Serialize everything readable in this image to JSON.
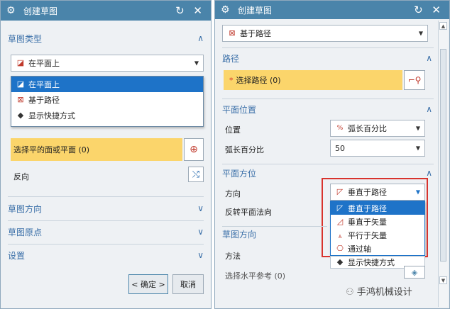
{
  "left": {
    "title": "创建草图",
    "title_controls": "↻ ✕",
    "sections": {
      "sketch_type": "草图类型",
      "sketch_orient": "草图方向",
      "sketch_origin": "草图原点",
      "settings": "设置"
    },
    "type_select": "在平面上",
    "type_options": [
      "在平面上",
      "基于路径",
      "显示快捷方式"
    ],
    "select_plane": "选择平的面或平面 (0)",
    "reverse": "反向",
    "ok": "< 确定 >",
    "cancel": "取消"
  },
  "right": {
    "title": "创建草图",
    "title_controls": "↻ ✕",
    "type_select": "基于路径",
    "sections": {
      "path": "路径",
      "plane_pos": "平面位置",
      "plane_orient": "平面方位",
      "sketch_orient": "草图方向"
    },
    "select_path": "选择路径 (0)",
    "required_mark": "*",
    "position_label": "位置",
    "position_value": "弧长百分比",
    "arc_label": "弧长百分比",
    "arc_value": "50",
    "direction_label": "方向",
    "direction_value": "垂直于路径",
    "reverse_normal": "反转平面法向",
    "direction_options": [
      "垂直于路径",
      "垂直于矢量",
      "平行于矢量",
      "通过轴"
    ],
    "method_label": "方法",
    "horiz_ref": "选择水平参考 (0)",
    "show_shortcuts": "显示快捷方式"
  },
  "watermark": "手鸿机械设计",
  "colors": {
    "titlebar": "#4a84aa",
    "section_text": "#3a6fa8",
    "selection_yellow": "#fbd56b",
    "highlight": "#1e73c8",
    "callout_red": "#d8332d"
  }
}
